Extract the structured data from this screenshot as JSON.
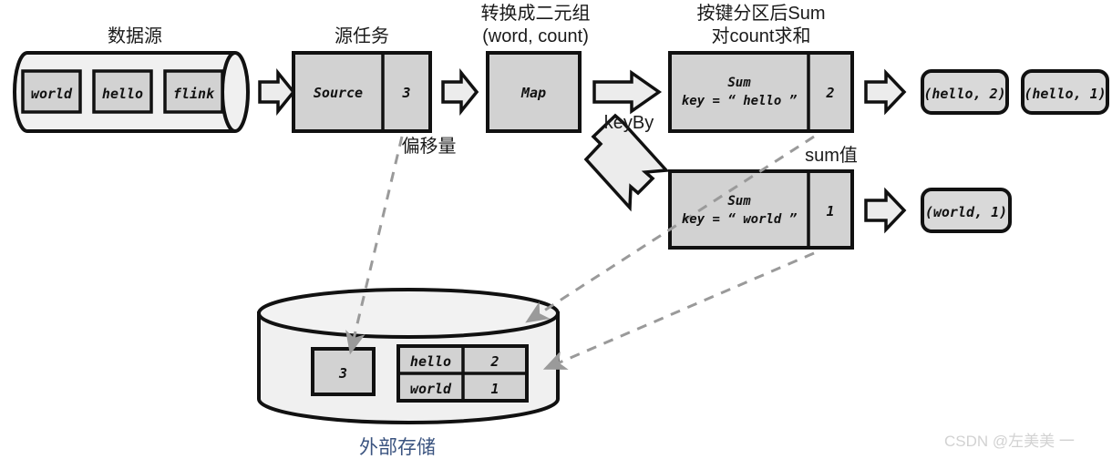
{
  "diagram": {
    "title_labels": {
      "source_data": "数据源",
      "source_task": "源任务",
      "map_line1": "转换成二元组",
      "map_line2": "(word, count)",
      "sum_line1": "按键分区后Sum",
      "sum_line2": "对count求和",
      "offset": "偏移量",
      "key_by": "keyBy",
      "sum_value": "sum值",
      "external_storage": "外部存储"
    },
    "source_cylinder": {
      "items": [
        "world",
        "hello",
        "flink"
      ]
    },
    "source_task": {
      "name": "Source",
      "state": "3"
    },
    "map_task": {
      "name": "Map"
    },
    "sum_tasks": [
      {
        "name": "Sum",
        "key": "key = “ hello ”",
        "state": "2"
      },
      {
        "name": "Sum",
        "key": "key = “ world ”",
        "state": "1"
      }
    ],
    "outputs": [
      "(hello, 2)",
      "(hello, 1)",
      "(world, 1)"
    ],
    "external_storage": {
      "offset_box": "3",
      "table": [
        {
          "word": "hello",
          "count": "2"
        },
        {
          "word": "world",
          "count": "1"
        }
      ]
    }
  },
  "watermark": "CSDN @左美美 一",
  "colors": {
    "box_fill": "#d2d2d2",
    "arrow_fill": "#ececec",
    "cylinder_fill": "#f0f0f0",
    "stroke": "#111111",
    "dashed": "#9a9a9a",
    "label_blue": "#3b5480",
    "watermark": "#d2d2d2"
  }
}
